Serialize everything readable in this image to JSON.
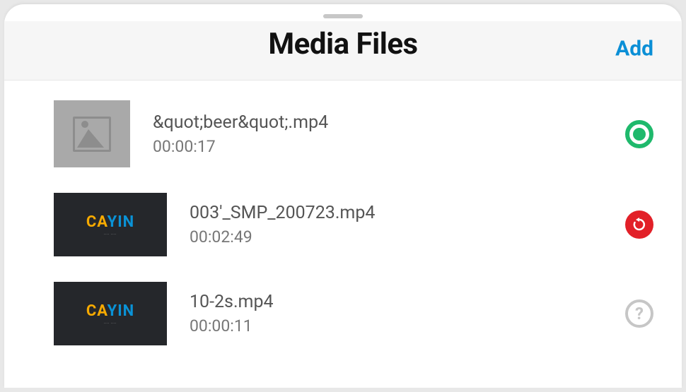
{
  "header": {
    "title": "Media Files",
    "add_label": "Add"
  },
  "files": [
    {
      "name": "&quot;beer&quot;.mp4",
      "duration": "00:00:17",
      "thumb_type": "placeholder",
      "status": "selected"
    },
    {
      "name": "003'_SMP_200723.mp4",
      "duration": "00:02:49",
      "thumb_type": "cayin",
      "status": "refresh"
    },
    {
      "name": "10-2s.mp4",
      "duration": "00:00:11",
      "thumb_type": "cayin",
      "status": "unknown"
    }
  ],
  "logo": {
    "text_c": "C",
    "text_a": "A",
    "text_yin": "YIN",
    "sub": "‧‧‧‧  ‧‧‧‧"
  }
}
